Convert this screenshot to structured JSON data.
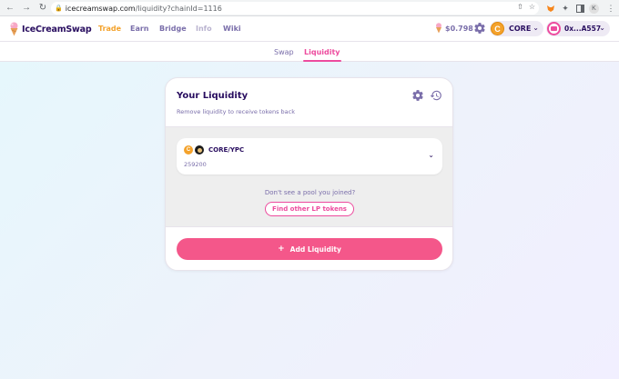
{
  "browser": {
    "url_host": "icecreamswap.com",
    "url_path": "/liquidity?chainId=1116"
  },
  "header": {
    "brand": "IceCreamSwap",
    "nav": [
      {
        "label": "Trade"
      },
      {
        "label": "Earn"
      },
      {
        "label": "Bridge"
      },
      {
        "label": "Info"
      },
      {
        "label": "Wiki"
      }
    ],
    "price": "$0.798",
    "network": "CORE",
    "network_icon": "C",
    "wallet": "0x...A557"
  },
  "subnav": {
    "swap": "Swap",
    "liquidity": "Liquidity"
  },
  "card": {
    "title": "Your Liquidity",
    "subtitle": "Remove liquidity to receive tokens back",
    "pool": {
      "token_a_icon": "C",
      "pair": "CORE/YPC",
      "amount": "259200"
    },
    "not_found": "Don't see a pool you joined?",
    "find_button": "Find other LP tokens",
    "add_button": "Add Liquidity"
  },
  "colors": {
    "accent": "#ed4b9e",
    "primary_button": "#f4578a",
    "nav_active": "#f4a22b",
    "text_primary": "#280d5f",
    "text_secondary": "#7a6eaa"
  }
}
